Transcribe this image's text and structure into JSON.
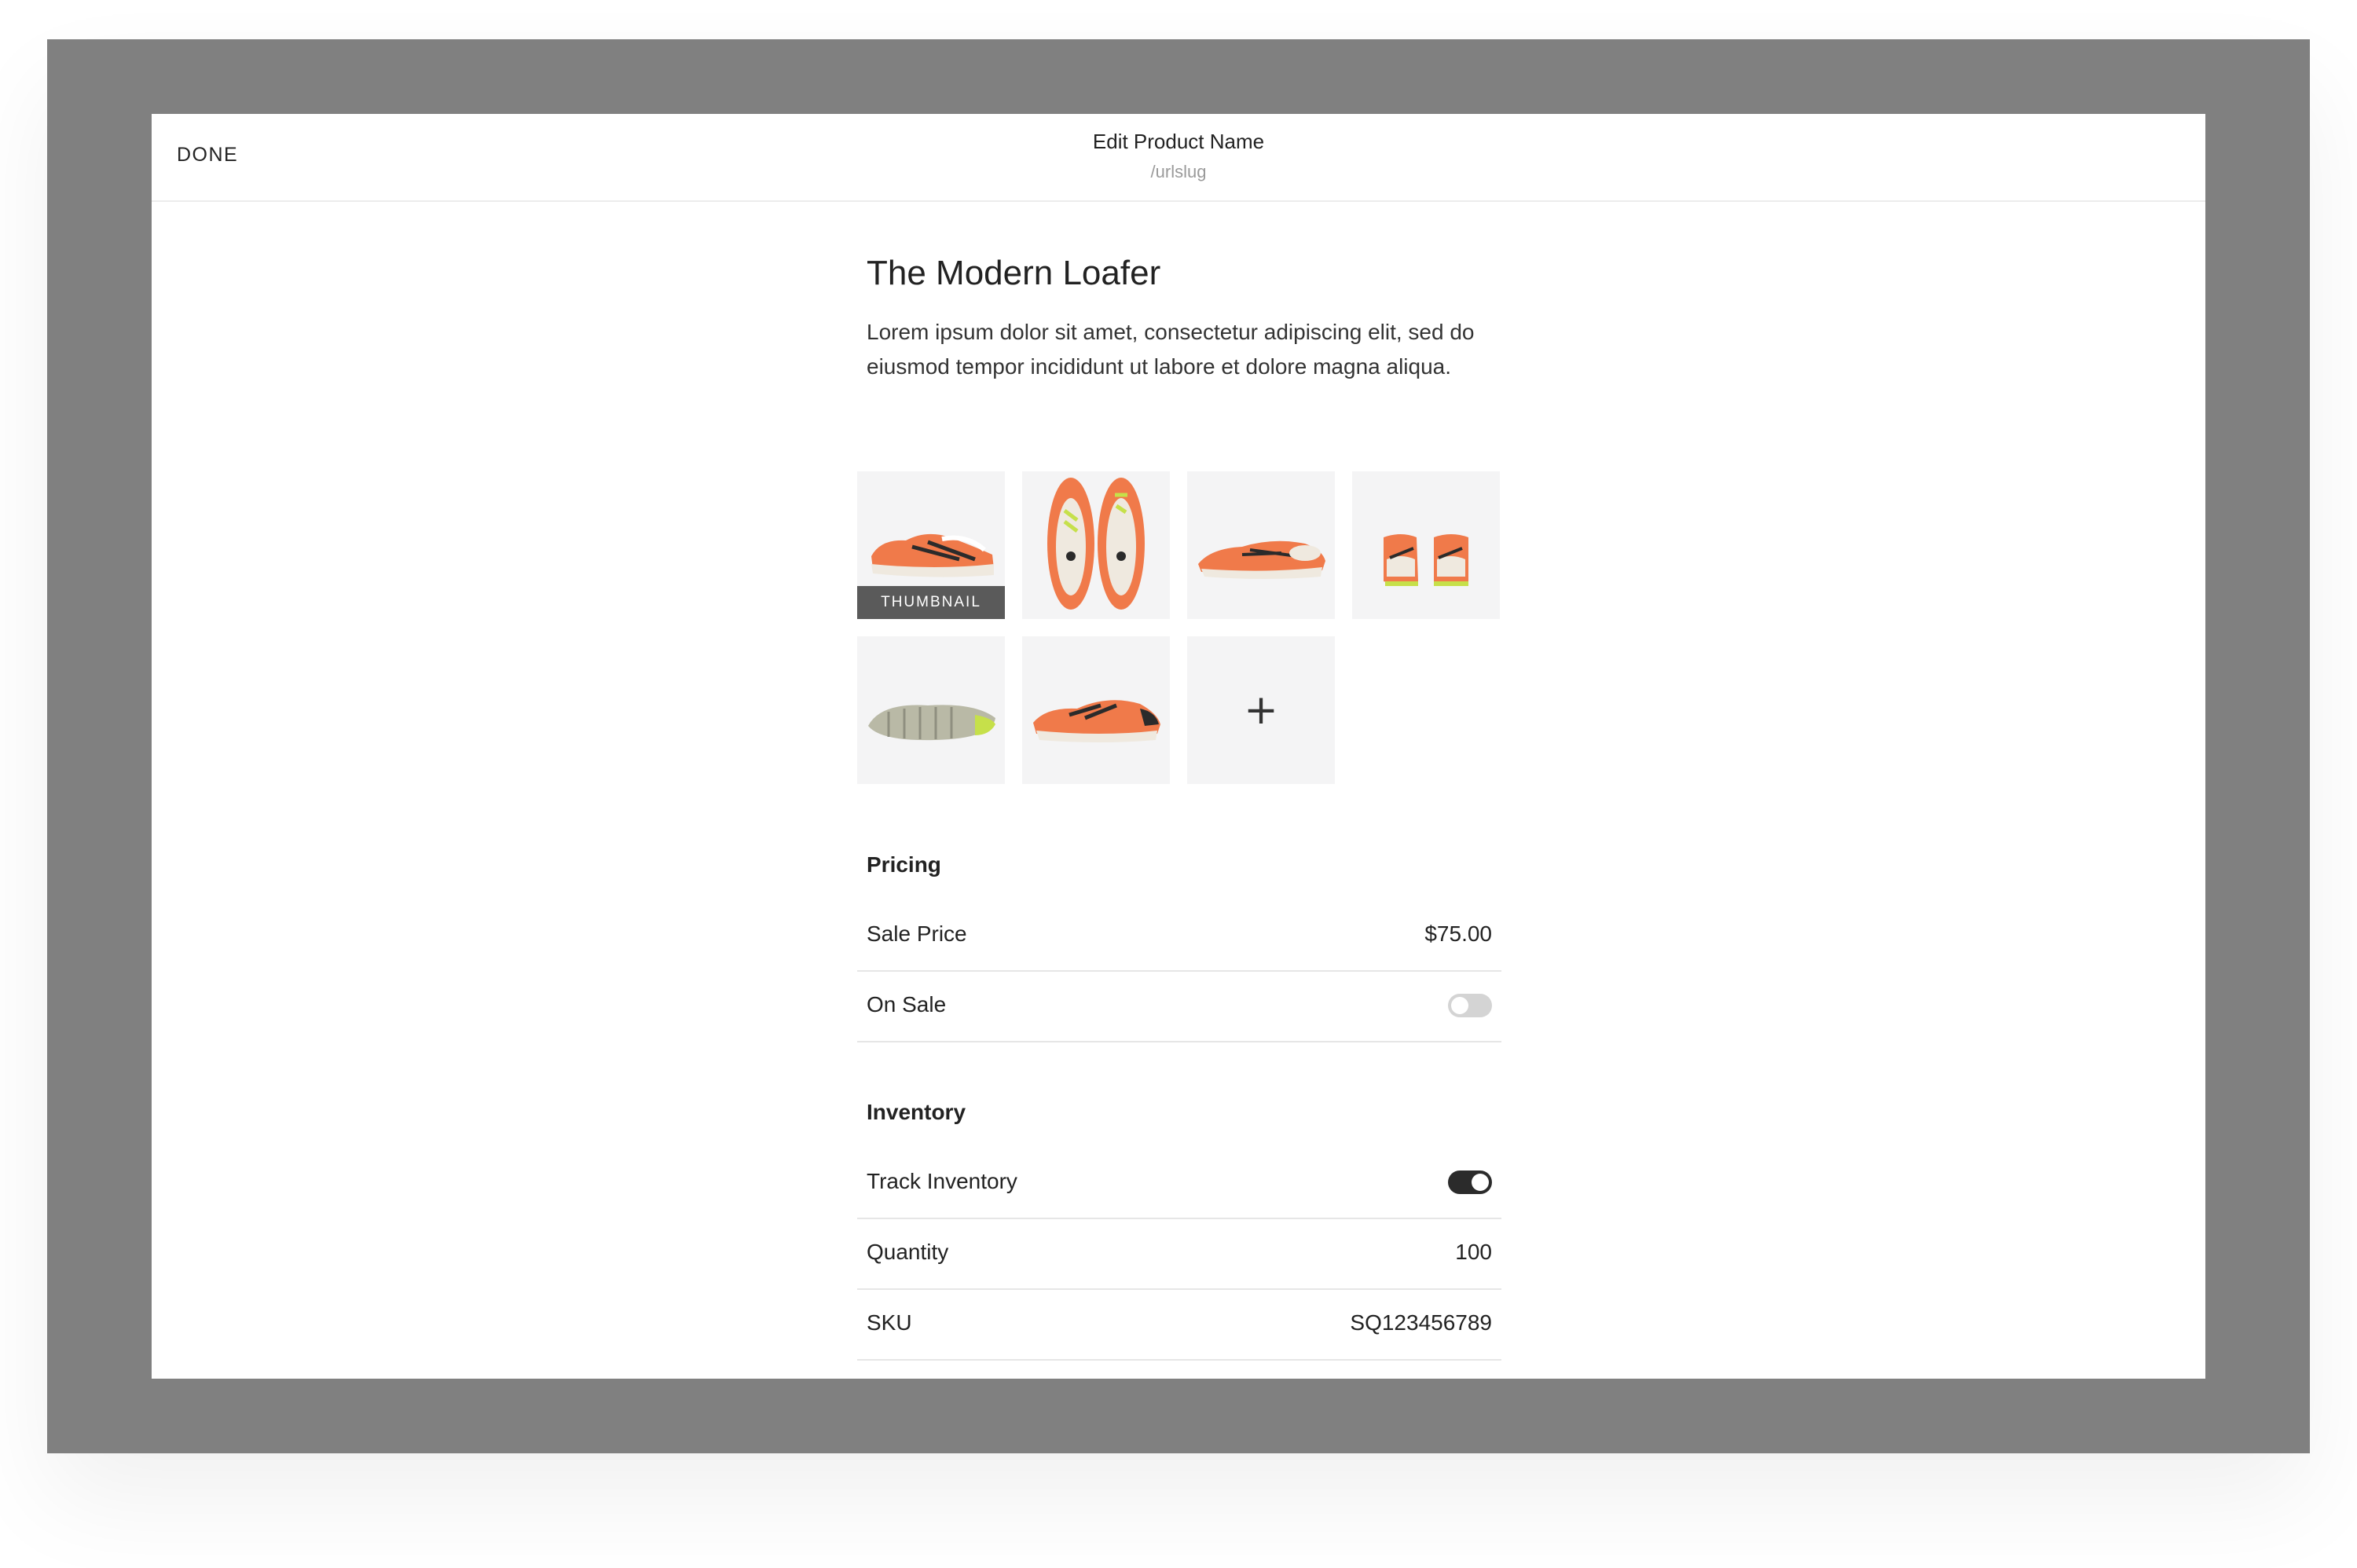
{
  "header": {
    "done_label": "DONE",
    "title": "Edit Product Name",
    "subtitle": "/urlslug"
  },
  "product": {
    "name": "The Modern Loafer",
    "description": "Lorem ipsum dolor sit amet, consectetur adipiscing elit, sed do eiusmod tempor incididunt ut labore et dolore magna aliqua."
  },
  "gallery": {
    "thumbnail_label": "THUMBNAIL",
    "add_icon": "plus-icon",
    "images": [
      "shoe-side-view",
      "shoe-top-view-pair",
      "shoe-angled-view",
      "shoe-rear-view-pair",
      "shoe-sole-view",
      "shoe-side-view-alt"
    ]
  },
  "pricing": {
    "title": "Pricing",
    "sale_price_label": "Sale Price",
    "sale_price_value": "$75.00",
    "on_sale_label": "On Sale",
    "on_sale_enabled": false
  },
  "inventory": {
    "title": "Inventory",
    "track_label": "Track Inventory",
    "track_enabled": true,
    "quantity_label": "Quantity",
    "quantity_value": "100",
    "sku_label": "SKU",
    "sku_value": "SQ123456789"
  },
  "colors": {
    "backdrop": "#808080",
    "tile_bg": "#f4f4f5",
    "shoe_orange": "#f07a4a",
    "toggle_on": "#2b2b2b",
    "toggle_off": "#d4d4d4"
  }
}
